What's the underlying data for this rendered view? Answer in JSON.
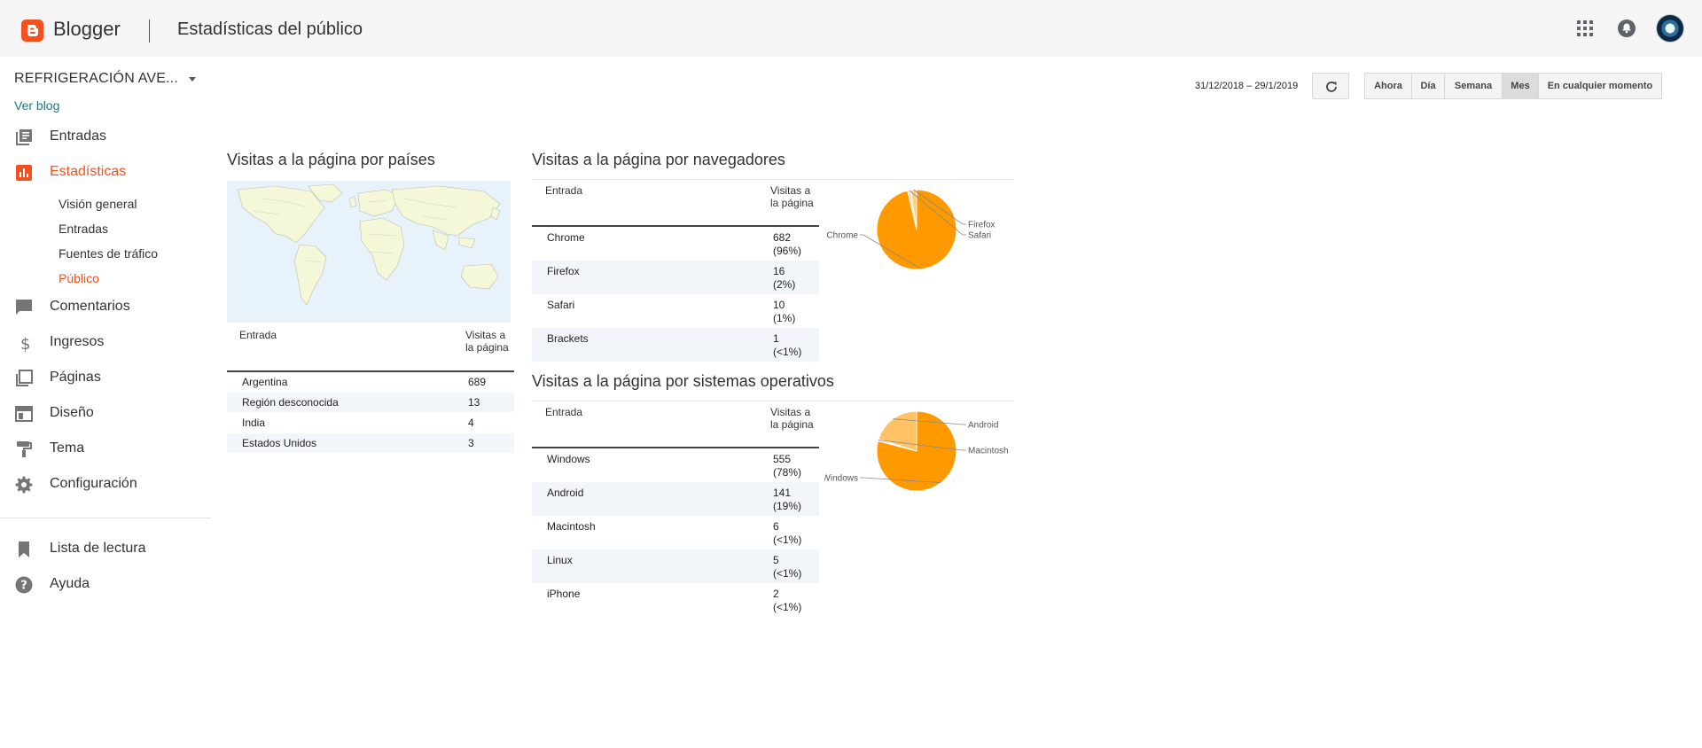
{
  "header": {
    "brand": "Blogger",
    "title": "Estadísticas del público",
    "accent": "#f4511e"
  },
  "sidebar": {
    "blog_name": "REFRIGERACIÓN AVE...",
    "view_blog": "Ver blog",
    "items": [
      {
        "label": "Entradas",
        "icon": "posts-icon"
      },
      {
        "label": "Estadísticas",
        "icon": "stats-icon",
        "active": true
      },
      {
        "label": "Comentarios",
        "icon": "comment-icon"
      },
      {
        "label": "Ingresos",
        "icon": "dollar-icon"
      },
      {
        "label": "Páginas",
        "icon": "pages-icon"
      },
      {
        "label": "Diseño",
        "icon": "layout-icon"
      },
      {
        "label": "Tema",
        "icon": "paint-roller-icon"
      },
      {
        "label": "Configuración",
        "icon": "gear-icon"
      },
      {
        "label": "Lista de lectura",
        "icon": "bookmark-icon"
      },
      {
        "label": "Ayuda",
        "icon": "help-icon"
      }
    ],
    "stats_sub": [
      "Visión general",
      "Entradas",
      "Fuentes de tráfico",
      "Público"
    ]
  },
  "toolbar": {
    "date_range": "31/12/2018 – 29/1/2019",
    "ranges": [
      "Ahora",
      "Día",
      "Semana",
      "Mes",
      "En cualquier momento"
    ],
    "selected_range": "Mes"
  },
  "countries": {
    "title": "Visitas a la página por países",
    "col_entry": "Entrada",
    "col_views": "Visitas a la página",
    "rows": [
      {
        "name": "Argentina",
        "views": "689"
      },
      {
        "name": "Región desconocida",
        "views": "13"
      },
      {
        "name": "India",
        "views": "4"
      },
      {
        "name": "Estados Unidos",
        "views": "3"
      }
    ]
  },
  "browsers": {
    "title": "Visitas a la página por navegadores",
    "col_entry": "Entrada",
    "col_views": "Visitas a la página",
    "rows": [
      {
        "name": "Chrome",
        "views": "682",
        "pct": "(96%)"
      },
      {
        "name": "Firefox",
        "views": "16",
        "pct": "(2%)"
      },
      {
        "name": "Safari",
        "views": "10",
        "pct": "(1%)"
      },
      {
        "name": "Brackets",
        "views": "1",
        "pct": "(<1%)"
      }
    ]
  },
  "os": {
    "title": "Visitas a la página por sistemas operativos",
    "col_entry": "Entrada",
    "col_views": "Visitas a la página",
    "rows": [
      {
        "name": "Windows",
        "views": "555",
        "pct": "(78%)"
      },
      {
        "name": "Android",
        "views": "141",
        "pct": "(19%)"
      },
      {
        "name": "Macintosh",
        "views": "6",
        "pct": "(<1%)"
      },
      {
        "name": "Linux",
        "views": "5",
        "pct": "(<1%)"
      },
      {
        "name": "iPhone",
        "views": "2",
        "pct": "(<1%)"
      }
    ]
  },
  "chart_data": [
    {
      "type": "pie",
      "categories": [
        "Chrome",
        "Firefox",
        "Safari"
      ],
      "values": [
        682,
        16,
        10
      ],
      "labels_shown": [
        "Chrome",
        "Firefox",
        "Safari"
      ],
      "colors": [
        "#ff9900",
        "#ffcc80",
        "#ffe0b2"
      ]
    },
    {
      "type": "pie",
      "categories": [
        "Windows",
        "Android",
        "Macintosh"
      ],
      "values": [
        555,
        141,
        6
      ],
      "labels_shown": [
        "Windows",
        "Android",
        "Macintosh"
      ],
      "colors": [
        "#ff9900",
        "#ffc266",
        "#ffe0b2"
      ]
    }
  ]
}
